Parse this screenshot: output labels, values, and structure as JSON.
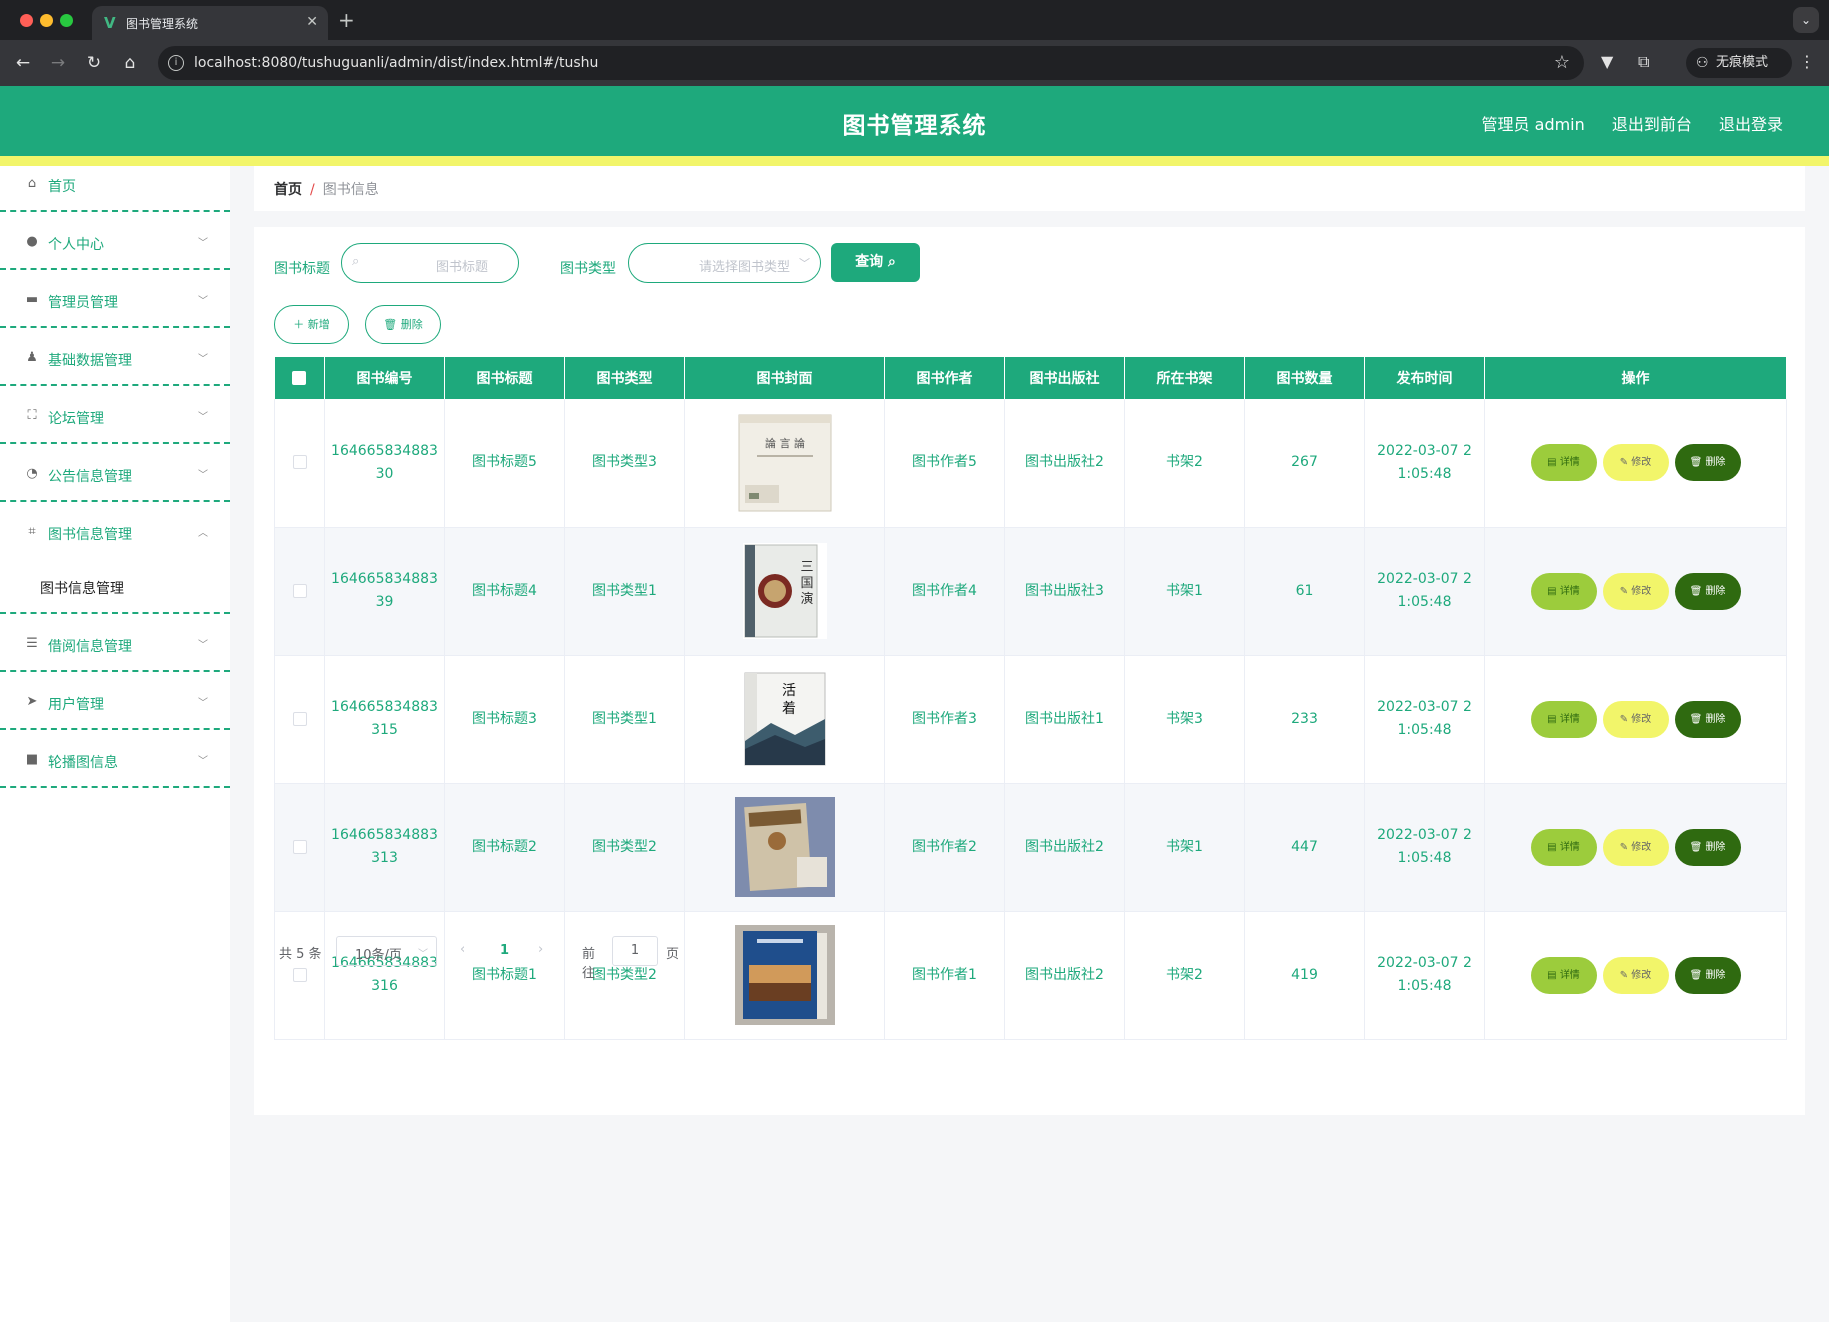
{
  "browser": {
    "tab_title": "图书管理系统",
    "url": "localhost:8080/tushuguanli/admin/dist/index.html#/tushu",
    "incognito_label": "无痕模式"
  },
  "header": {
    "title": "图书管理系统",
    "user_label": "管理员 admin",
    "front_label": "退出到前台",
    "logout_label": "退出登录"
  },
  "sidebar": {
    "items": [
      {
        "label": "首页",
        "icon": "home-icon"
      },
      {
        "label": "个人中心",
        "icon": "user-icon"
      },
      {
        "label": "管理员管理",
        "icon": "monitor-icon"
      },
      {
        "label": "基础数据管理",
        "icon": "person-icon"
      },
      {
        "label": "论坛管理",
        "icon": "fullscreen-icon"
      },
      {
        "label": "公告信息管理",
        "icon": "gauge-icon"
      },
      {
        "label": "图书信息管理",
        "icon": "crop-icon",
        "expanded": true,
        "sub": [
          "图书信息管理"
        ]
      },
      {
        "label": "借阅信息管理",
        "icon": "list-icon"
      },
      {
        "label": "用户管理",
        "icon": "send-icon"
      },
      {
        "label": "轮播图信息",
        "icon": "camera-icon"
      }
    ]
  },
  "breadcrumb": {
    "home": "首页",
    "current": "图书信息"
  },
  "filters": {
    "title_label": "图书标题",
    "title_placeholder": "图书标题",
    "type_label": "图书类型",
    "type_placeholder": "请选择图书类型",
    "query_label": "查询"
  },
  "actions": {
    "add_label": "新增",
    "delete_label": "删除"
  },
  "table": {
    "headers": [
      "图书编号",
      "图书标题",
      "图书类型",
      "图书封面",
      "图书作者",
      "图书出版社",
      "所在书架",
      "图书数量",
      "发布时间",
      "操作"
    ],
    "op_labels": {
      "detail": "详情",
      "edit": "修改",
      "delete": "删除"
    },
    "rows": [
      {
        "id_l1": "164665834883",
        "id_l2": "30",
        "title": "图书标题5",
        "type": "图书类型3",
        "cover": "book-cover-1",
        "author": "图书作者5",
        "press": "图书出版社2",
        "shelf": "书架2",
        "count": "267",
        "time_l1": "2022-03-07 2",
        "time_l2": "1:05:48"
      },
      {
        "id_l1": "164665834883",
        "id_l2": "39",
        "title": "图书标题4",
        "type": "图书类型1",
        "cover": "book-cover-2",
        "author": "图书作者4",
        "press": "图书出版社3",
        "shelf": "书架1",
        "count": "61",
        "time_l1": "2022-03-07 2",
        "time_l2": "1:05:48"
      },
      {
        "id_l1": "164665834883",
        "id_l2": "315",
        "title": "图书标题3",
        "type": "图书类型1",
        "cover": "book-cover-3",
        "author": "图书作者3",
        "press": "图书出版社1",
        "shelf": "书架3",
        "count": "233",
        "time_l1": "2022-03-07 2",
        "time_l2": "1:05:48"
      },
      {
        "id_l1": "164665834883",
        "id_l2": "313",
        "title": "图书标题2",
        "type": "图书类型2",
        "cover": "book-cover-4",
        "author": "图书作者2",
        "press": "图书出版社2",
        "shelf": "书架1",
        "count": "447",
        "time_l1": "2022-03-07 2",
        "time_l2": "1:05:48"
      },
      {
        "id_l1": "164665834883",
        "id_l2": "316",
        "title": "图书标题1",
        "type": "图书类型2",
        "cover": "book-cover-5",
        "author": "图书作者1",
        "press": "图书出版社2",
        "shelf": "书架2",
        "count": "419",
        "time_l1": "2022-03-07 2",
        "time_l2": "1:05:48"
      }
    ]
  },
  "pagination": {
    "total": "共 5 条",
    "page_size": "10条/页",
    "current_page": "1",
    "goto_label": "前往",
    "goto_value": "1",
    "page_suffix": "页"
  },
  "colors": {
    "primary": "#1ea97c",
    "stripe": "#f2f56a",
    "detail": "#9ccc3c",
    "edit": "#f2f56a",
    "delete": "#2f6a10"
  }
}
